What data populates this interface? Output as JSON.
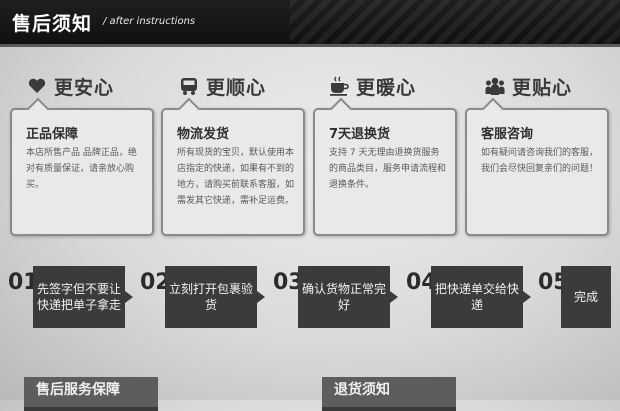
{
  "header": {
    "title": "售后须知",
    "subtitle": "/ after instructions"
  },
  "categories": [
    {
      "label": "更安心",
      "icon": "heart-icon"
    },
    {
      "label": "更顺心",
      "icon": "bus-icon"
    },
    {
      "label": "更暖心",
      "icon": "coffee-cup-icon"
    },
    {
      "label": "更贴心",
      "icon": "group-icon"
    }
  ],
  "boxes": [
    {
      "title": "正品保障",
      "body": "本店所售产品 品牌正品，绝对有质量保证，请亲放心购买。"
    },
    {
      "title": "物流发货",
      "body": "所有现货的宝贝，默认使用本店指定的快递，如果有不到的地方，请购买前联系客服，如需发其它快递，需补足运费。"
    },
    {
      "title": "7天退换货",
      "body": "支持 7 天无理由退换货服务的商品类目，服务申请流程和退换条件。"
    },
    {
      "title": "客服咨询",
      "body": "如有疑问请咨询我们的客服，我们会尽快回复亲们的问题！"
    }
  ],
  "steps": [
    {
      "num": "01",
      "text": "先签字但不要让快递把单子拿走"
    },
    {
      "num": "02",
      "text": "立刻打开包裹验货"
    },
    {
      "num": "03",
      "text": "确认货物正常完好"
    },
    {
      "num": "04",
      "text": "把快递单交给快递"
    },
    {
      "num": "05",
      "text": "完成"
    }
  ],
  "bottom": {
    "left_tab": "售后服务保障",
    "right_tab": "退货须知"
  },
  "colors": {
    "header_bg": "#141414",
    "step_bg": "#3b3b3b",
    "box_bg": "#e9e9e9"
  }
}
